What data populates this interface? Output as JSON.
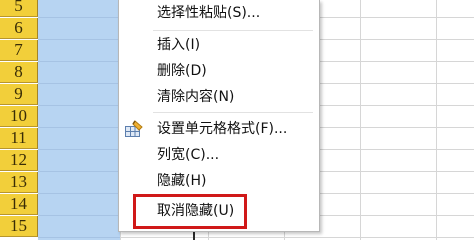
{
  "row_headers": [
    "5",
    "6",
    "7",
    "8",
    "9",
    "10",
    "11",
    "12",
    "13",
    "14",
    "15"
  ],
  "context_menu": {
    "items": [
      {
        "label": "选择性粘贴(S)...",
        "name": "menu-item-paste-special",
        "icon": ""
      },
      {
        "label": "插入(I)",
        "name": "menu-item-insert",
        "icon": ""
      },
      {
        "label": "删除(D)",
        "name": "menu-item-delete",
        "icon": ""
      },
      {
        "label": "清除内容(N)",
        "name": "menu-item-clear-contents",
        "icon": ""
      },
      {
        "label": "设置单元格格式(F)...",
        "name": "menu-item-format-cells",
        "icon": "format-cells-icon"
      },
      {
        "label": "列宽(C)...",
        "name": "menu-item-column-width",
        "icon": ""
      },
      {
        "label": "隐藏(H)",
        "name": "menu-item-hide",
        "icon": ""
      },
      {
        "label": "取消隐藏(U)",
        "name": "menu-item-unhide",
        "icon": ""
      }
    ]
  },
  "colors": {
    "row_header": "#f2cf3a",
    "selected_column": "#b7d4f2",
    "highlight_box": "#d01818"
  }
}
